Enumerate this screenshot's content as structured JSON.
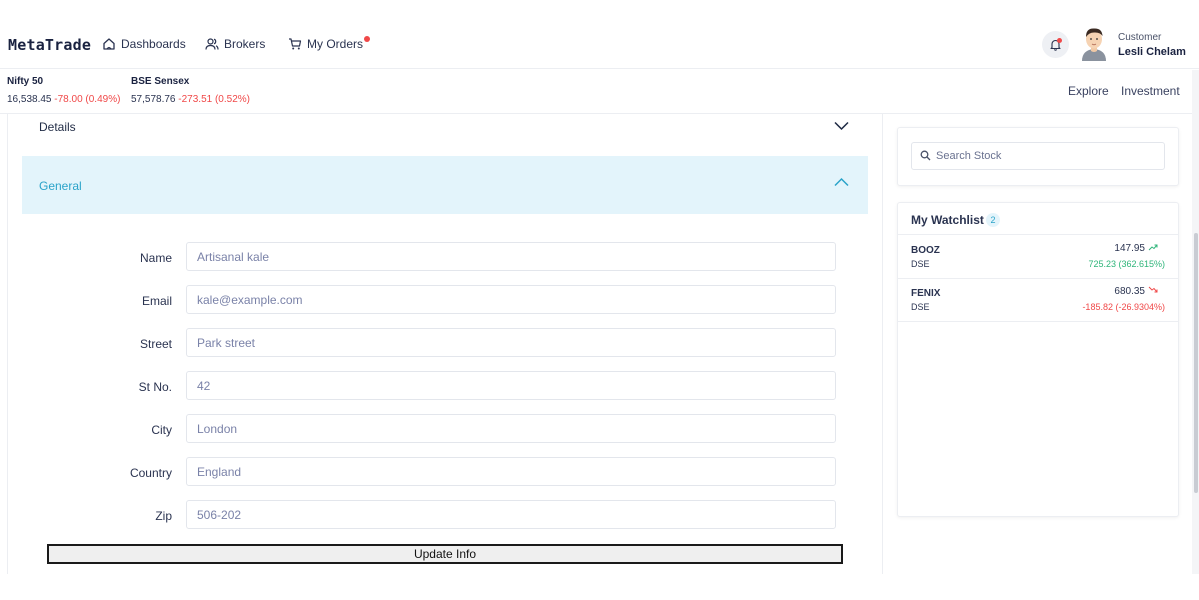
{
  "header": {
    "logo": "MetaTrade",
    "nav": {
      "dashboards": "Dashboards",
      "brokers": "Brokers",
      "orders": "My Orders"
    },
    "user": {
      "role": "Customer",
      "name": "Lesli Chelam"
    }
  },
  "ticker": {
    "nifty": {
      "name": "Nifty 50",
      "value": "16,538.45",
      "change": "-78.00 (0.49%)"
    },
    "bse": {
      "name": "BSE Sensex",
      "value": "57,578.76",
      "change": "-273.51 (0.52%)"
    }
  },
  "top_links": {
    "explore": "Explore",
    "investment": "Investment"
  },
  "accordion": {
    "details_title": "Details",
    "general_title": "General"
  },
  "form": {
    "name_label": "Name",
    "name_value": "Artisanal kale",
    "email_label": "Email",
    "email_value": "kale@example.com",
    "street_label": "Street",
    "street_value": "Park street",
    "stno_label": "St No.",
    "stno_value": "42",
    "city_label": "City",
    "city_value": "London",
    "country_label": "Country",
    "country_value": "England",
    "zip_label": "Zip",
    "zip_value": "506-202",
    "submit_label": "Update Info"
  },
  "search": {
    "placeholder": "Search Stock"
  },
  "watchlist": {
    "title": "My Watchlist",
    "count": "2",
    "items": [
      {
        "symbol": "BOOZ",
        "exchange": "DSE",
        "price": "147.95",
        "change": "725.23 (362.615%)",
        "direction": "up"
      },
      {
        "symbol": "FENIX",
        "exchange": "DSE",
        "price": "680.35",
        "change": "-185.82 (-26.9304%)",
        "direction": "down"
      }
    ]
  },
  "colors": {
    "accent": "#2aa3c9",
    "up": "#2fb57a",
    "down": "#f04848",
    "accordion_bg": "#e3f4fb"
  }
}
